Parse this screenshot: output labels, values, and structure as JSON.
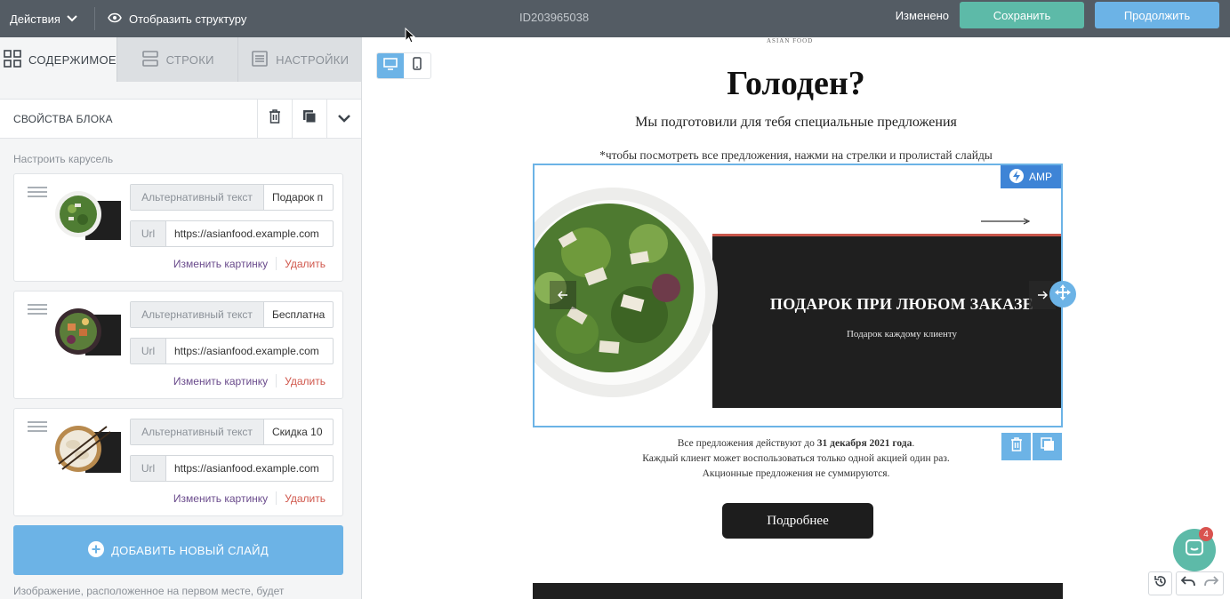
{
  "topbar": {
    "actions_label": "Действия",
    "structure_label": "Отобразить структуру",
    "doc_id": "ID203965038",
    "status": "Изменено",
    "save_label": "Сохранить",
    "continue_label": "Продолжить"
  },
  "sidebar": {
    "tabs": [
      {
        "label": "СОДЕРЖИМОЕ",
        "icon": "grid-icon",
        "active": true
      },
      {
        "label": "СТРОКИ",
        "icon": "rows-icon",
        "active": false
      },
      {
        "label": "НАСТРОЙКИ",
        "icon": "settings-icon",
        "active": false
      }
    ],
    "props_title": "СВОЙСТВА БЛОКА",
    "carousel_label": "Настроить карусель",
    "slides": [
      {
        "alt_label": "Альтернативный текст",
        "alt_value": "Подарок п",
        "url_label": "Url",
        "url_value": "https://asianfood.example.com",
        "change_label": "Изменить картинку",
        "delete_label": "Удалить"
      },
      {
        "alt_label": "Альтернативный текст",
        "alt_value": "Бесплатна",
        "url_label": "Url",
        "url_value": "https://asianfood.example.com",
        "change_label": "Изменить картинку",
        "delete_label": "Удалить"
      },
      {
        "alt_label": "Альтернативный текст",
        "alt_value": "Скидка 10",
        "url_label": "Url",
        "url_value": "https://asianfood.example.com",
        "change_label": "Изменить картинку",
        "delete_label": "Удалить"
      }
    ],
    "add_slide_label": "ДОБАВИТЬ НОВЫЙ СЛАЙД",
    "hint": "Изображение, расположенное на первом месте, будет"
  },
  "email": {
    "brand": "ASIAN FOOD",
    "headline": "Голоден?",
    "subtitle": "Мы подготовили для тебя специальные предложения",
    "note": "*чтобы посмотреть все предложения, нажми на стрелки и пролистай слайды",
    "amp_label": "AMP",
    "banner_title": "ПОДАРОК ПРИ ЛЮБОМ ЗАКАЗЕ",
    "banner_subtitle": "Подарок каждому клиенту",
    "terms_line1_pre": "Все предложения действуют до ",
    "terms_line1_bold": "31 декабря 2021 года",
    "terms_line1_post": ".",
    "terms_line2": "Каждый клиент может воспользоваться только одной акцией один раз.",
    "terms_line3": "Акционные предложения не суммируются.",
    "cta_label": "Подробнее"
  },
  "widgets": {
    "chat_badge": "4"
  },
  "colors": {
    "topbar": "#545c64",
    "save": "#5dbaa8",
    "accent": "#6cb3e6",
    "amp": "#3e84d6",
    "banner_dark": "#1f1f1f",
    "delete_link": "#d0574c"
  }
}
